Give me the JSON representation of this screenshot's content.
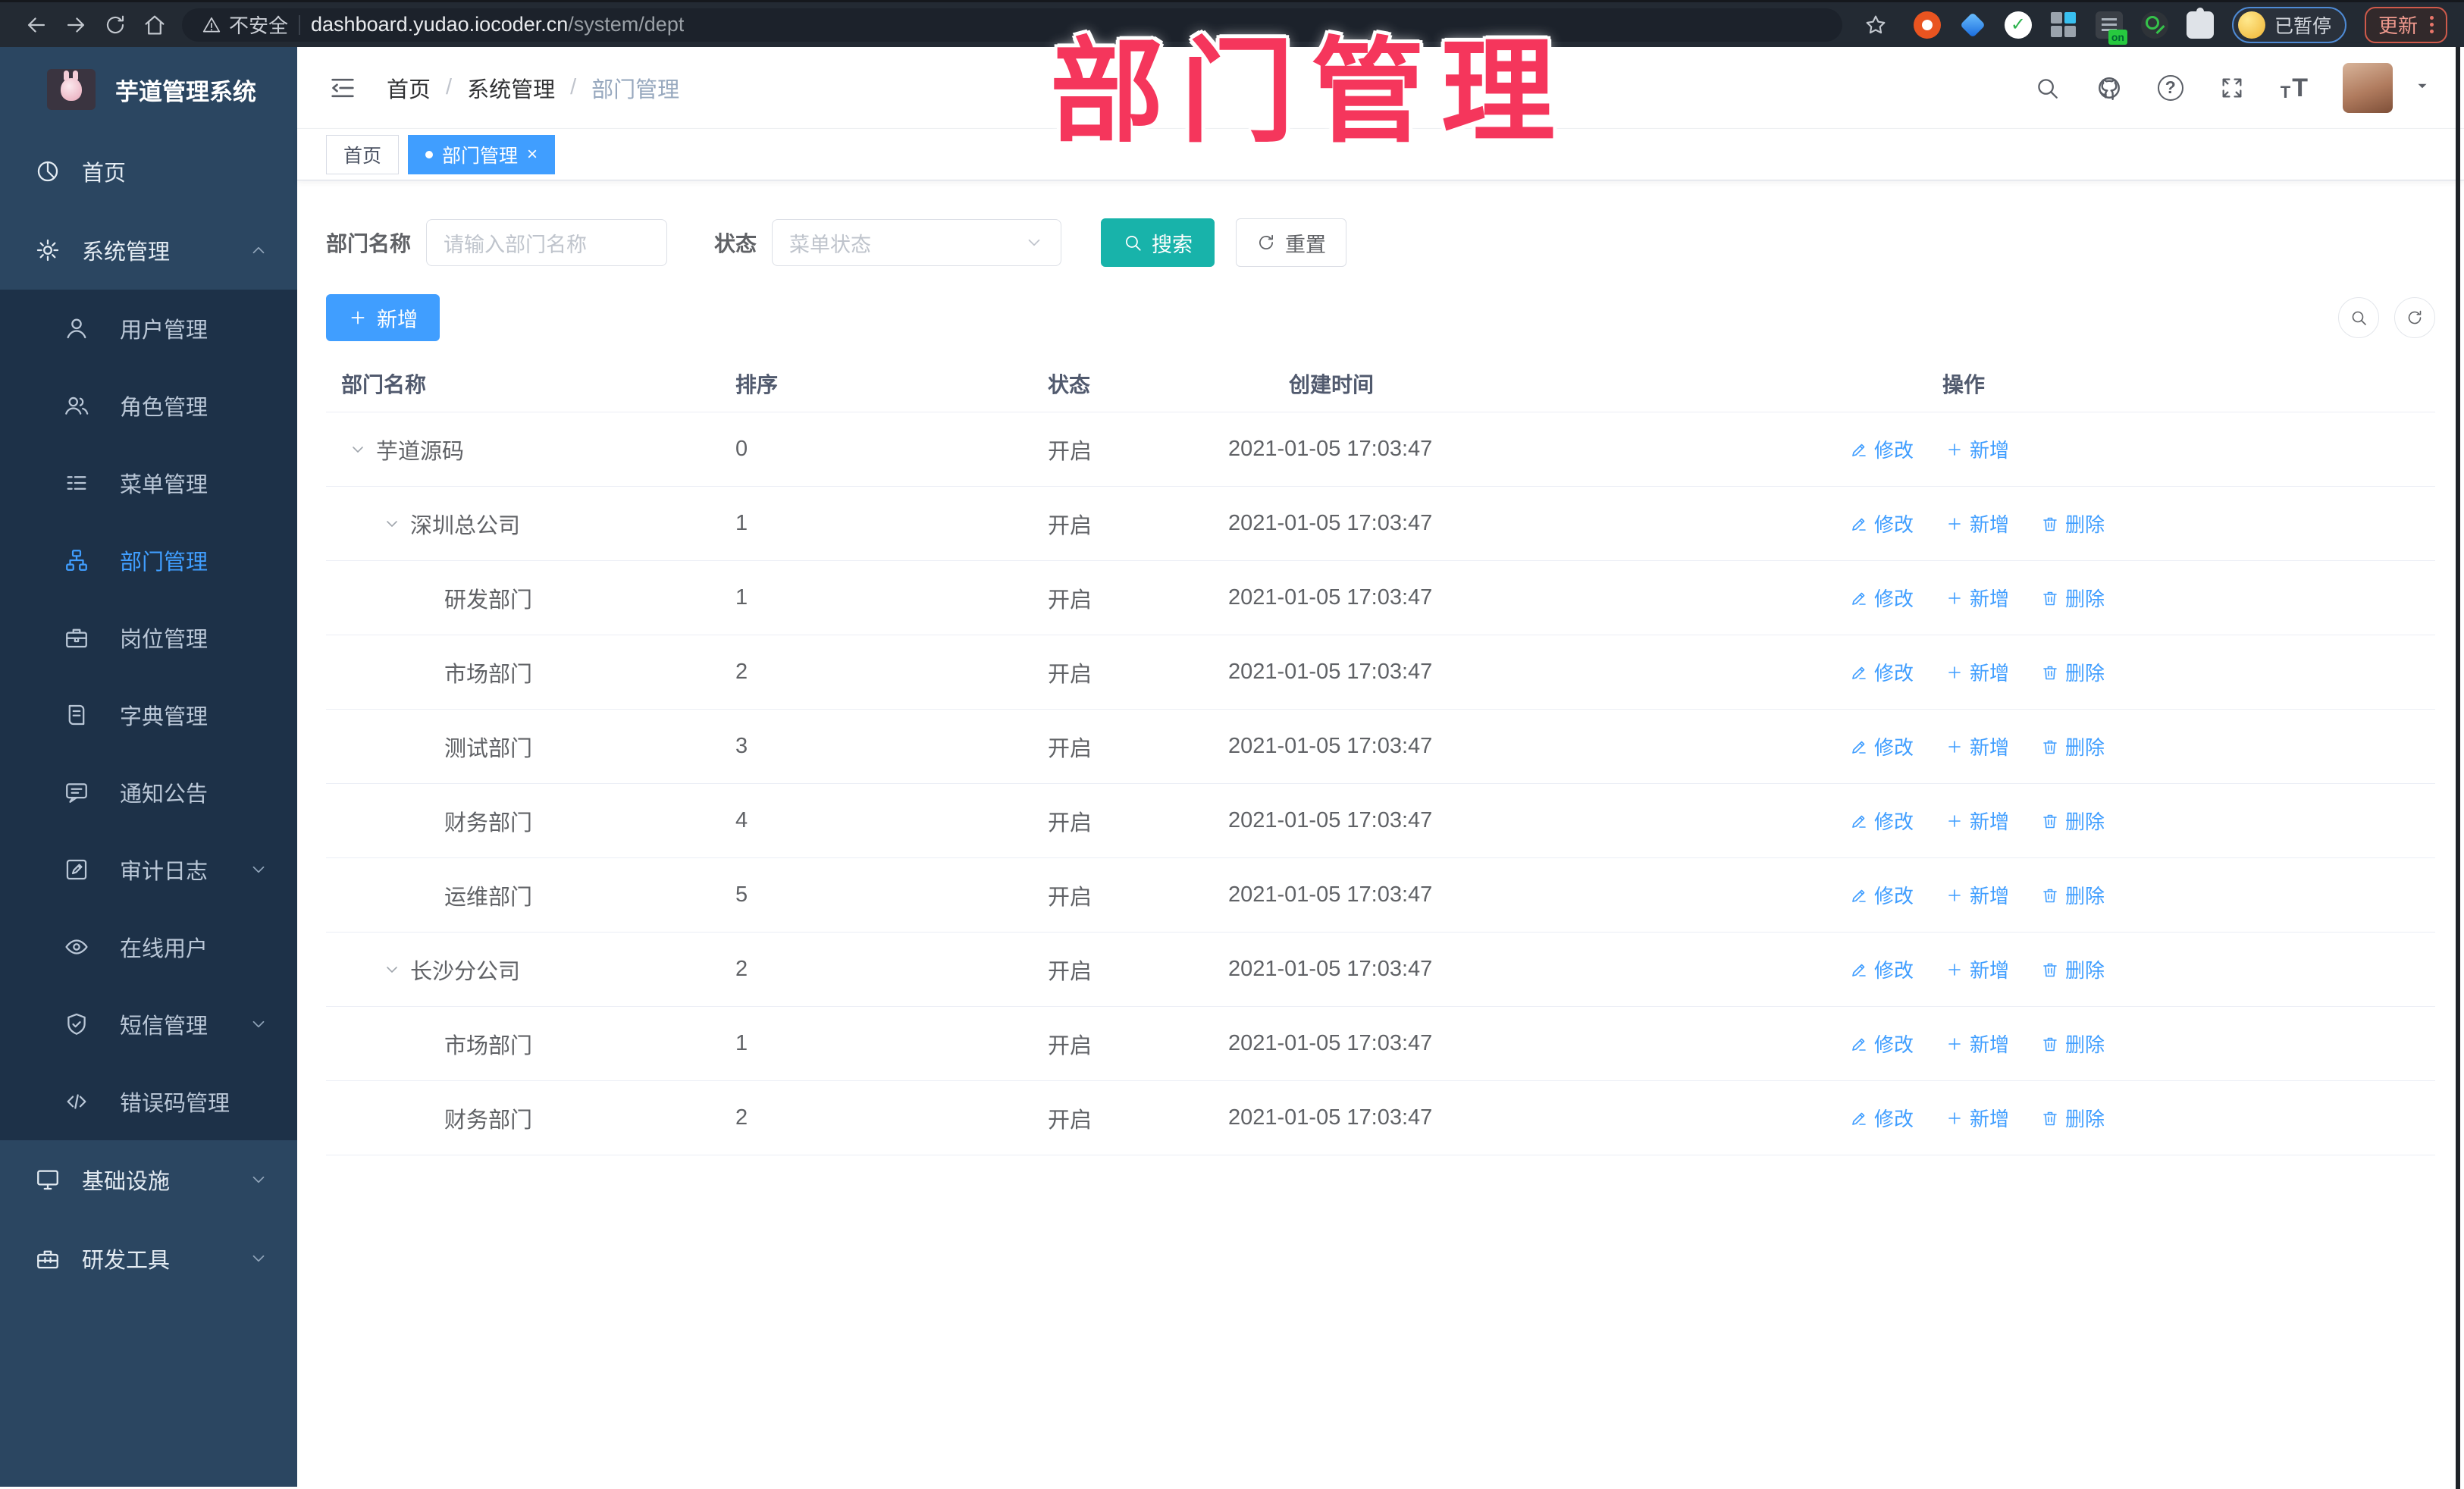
{
  "browser": {
    "security_label": "不安全",
    "url_host": "dashboard.yudao.iocoder.cn",
    "url_path": "/system/dept",
    "profile_status": "已暂停",
    "update_label": "更新"
  },
  "watermark": "部门管理",
  "sidebar": {
    "title": "芋道管理系统",
    "items": [
      {
        "label": "首页",
        "icon": "dashboard-icon",
        "ref": "#i-dash",
        "level": "top"
      },
      {
        "label": "系统管理",
        "icon": "gear-icon",
        "ref": "#i-gear",
        "level": "top",
        "chevron": "up"
      },
      {
        "label": "用户管理",
        "icon": "user-icon",
        "ref": "#i-user",
        "level": "sub"
      },
      {
        "label": "角色管理",
        "icon": "users-icon",
        "ref": "#i-users",
        "level": "sub"
      },
      {
        "label": "菜单管理",
        "icon": "menu-list-icon",
        "ref": "#i-list",
        "level": "sub"
      },
      {
        "label": "部门管理",
        "icon": "org-tree-icon",
        "ref": "#i-tree",
        "level": "sub",
        "active": true
      },
      {
        "label": "岗位管理",
        "icon": "briefcase-icon",
        "ref": "#i-brief",
        "level": "sub"
      },
      {
        "label": "字典管理",
        "icon": "dictionary-icon",
        "ref": "#i-book",
        "level": "sub"
      },
      {
        "label": "通知公告",
        "icon": "announcement-icon",
        "ref": "#i-bubble",
        "level": "sub"
      },
      {
        "label": "审计日志",
        "icon": "audit-log-icon",
        "ref": "#i-editlog",
        "level": "sub",
        "chevron": "down"
      },
      {
        "label": "在线用户",
        "icon": "online-users-icon",
        "ref": "#i-eye",
        "level": "sub"
      },
      {
        "label": "短信管理",
        "icon": "sms-shield-icon",
        "ref": "#i-shield",
        "level": "sub",
        "chevron": "down"
      },
      {
        "label": "错误码管理",
        "icon": "error-code-icon",
        "ref": "#i-code",
        "level": "sub"
      },
      {
        "label": "基础设施",
        "icon": "infrastructure-icon",
        "ref": "#i-monitor",
        "level": "top",
        "chevron": "down"
      },
      {
        "label": "研发工具",
        "icon": "dev-tools-icon",
        "ref": "#i-toolbox",
        "level": "top",
        "chevron": "down"
      }
    ]
  },
  "header": {
    "breadcrumb": [
      "首页",
      "系统管理",
      "部门管理"
    ]
  },
  "tabs": [
    {
      "label": "首页"
    },
    {
      "label": "部门管理",
      "active": true,
      "dot": true,
      "closable": true
    }
  ],
  "filters": {
    "dept_label": "部门名称",
    "dept_placeholder": "请输入部门名称",
    "status_label": "状态",
    "status_placeholder": "菜单状态",
    "search_label": "搜索",
    "reset_label": "重置"
  },
  "toolbar": {
    "add_label": "新增"
  },
  "table": {
    "columns": [
      "部门名称",
      "排序",
      "状态",
      "创建时间",
      "操作"
    ],
    "ops": {
      "edit": "修改",
      "add": "新增",
      "delete": "删除"
    },
    "rows": [
      {
        "name": "芋道源码",
        "level": 0,
        "expandable": true,
        "sort": "0",
        "status": "开启",
        "created": "2021-01-05 17:03:47",
        "can_delete": false
      },
      {
        "name": "深圳总公司",
        "level": 1,
        "expandable": true,
        "sort": "1",
        "status": "开启",
        "created": "2021-01-05 17:03:47",
        "can_delete": true
      },
      {
        "name": "研发部门",
        "level": 2,
        "expandable": false,
        "sort": "1",
        "status": "开启",
        "created": "2021-01-05 17:03:47",
        "can_delete": true
      },
      {
        "name": "市场部门",
        "level": 2,
        "expandable": false,
        "sort": "2",
        "status": "开启",
        "created": "2021-01-05 17:03:47",
        "can_delete": true
      },
      {
        "name": "测试部门",
        "level": 2,
        "expandable": false,
        "sort": "3",
        "status": "开启",
        "created": "2021-01-05 17:03:47",
        "can_delete": true
      },
      {
        "name": "财务部门",
        "level": 2,
        "expandable": false,
        "sort": "4",
        "status": "开启",
        "created": "2021-01-05 17:03:47",
        "can_delete": true
      },
      {
        "name": "运维部门",
        "level": 2,
        "expandable": false,
        "sort": "5",
        "status": "开启",
        "created": "2021-01-05 17:03:47",
        "can_delete": true
      },
      {
        "name": "长沙分公司",
        "level": 1,
        "expandable": true,
        "sort": "2",
        "status": "开启",
        "created": "2021-01-05 17:03:47",
        "can_delete": true
      },
      {
        "name": "市场部门",
        "level": 2,
        "expandable": false,
        "sort": "1",
        "status": "开启",
        "created": "2021-01-05 17:03:47",
        "can_delete": true
      },
      {
        "name": "财务部门",
        "level": 2,
        "expandable": false,
        "sort": "2",
        "status": "开启",
        "created": "2021-01-05 17:03:47",
        "can_delete": true
      }
    ]
  },
  "colors": {
    "accent": "#409eff",
    "search_button": "#18b3aa",
    "watermark": "#f5365c",
    "sidebar_top": "#2b4661",
    "sidebar_sub": "#1d3148"
  }
}
